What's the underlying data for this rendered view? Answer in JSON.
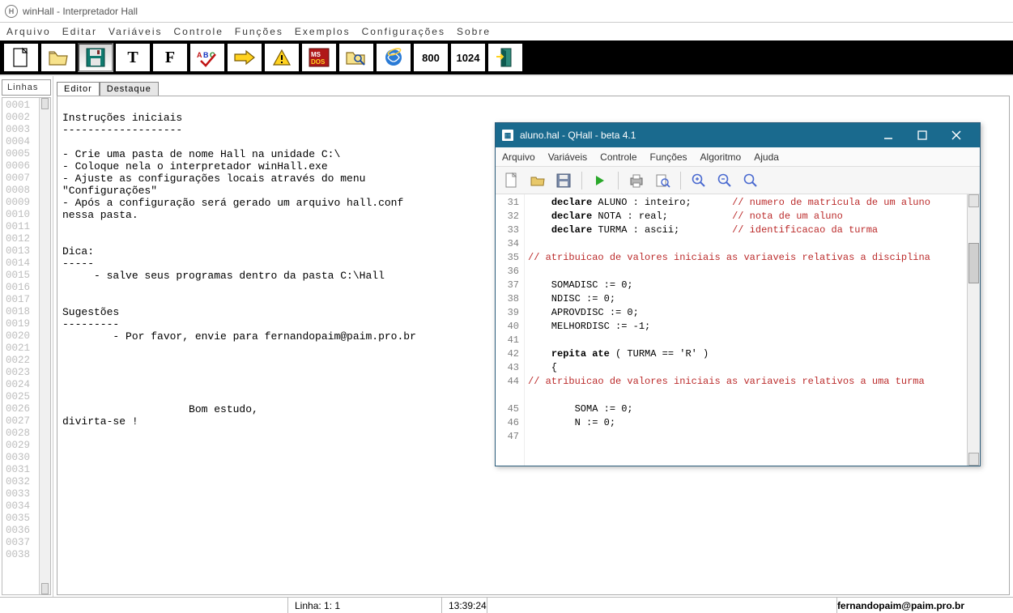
{
  "titlebar": {
    "title": "winHall - Interpretador Hall"
  },
  "menubar": {
    "items": [
      "Arquivo",
      "Editar",
      "Variáveis",
      "Controle",
      "Funções",
      "Exemplos",
      "Configurações",
      "Sobre"
    ]
  },
  "toolbar": {
    "size1": "800",
    "size2": "1024"
  },
  "linhas": {
    "label": "Linhas",
    "numbers": "0001\n0002\n0003\n0004\n0005\n0006\n0007\n0008\n0009\n0010\n0011\n0012\n0013\n0014\n0015\n0016\n0017\n0018\n0019\n0020\n0021\n0022\n0023\n0024\n0025\n0026\n0027\n0028\n0029\n0030\n0031\n0032\n0033\n0034\n0035\n0036\n0037\n0038"
  },
  "editor": {
    "tabs": {
      "active": "Editor",
      "inactive": "Destaque"
    },
    "text": "\nInstruções iniciais\n-------------------\n\n- Crie uma pasta de nome Hall na unidade C:\\\n- Coloque nela o interpretador winHall.exe\n- Ajuste as configurações locais através do menu\n\"Configurações\"\n- Após a configuração será gerado um arquivo hall.conf\nnessa pasta.\n\n\nDica:\n-----\n     - salve seus programas dentro da pasta C:\\Hall\n\n\nSugestões\n---------\n        - Por favor, envie para fernandopaim@paim.pro.br\n\n\n\n\n\n                    Bom estudo,\ndivirta-se !"
  },
  "qhall": {
    "title": "aluno.hal - QHall - beta 4.1",
    "menu": [
      "Arquivo",
      "Variáveis",
      "Controle",
      "Funções",
      "Algoritmo",
      "Ajuda"
    ],
    "gutter": "31\n32\n33\n34\n35\n36\n37\n38\n39\n40\n41\n42\n43\n44\n\n45\n46\n47",
    "lines": [
      {
        "indent": "    ",
        "kw": "declare",
        "rest": " ALUNO : inteiro;",
        "cmpad": "       ",
        "cm": "// numero de matricula de um aluno"
      },
      {
        "indent": "    ",
        "kw": "declare",
        "rest": " NOTA : real;",
        "cmpad": "           ",
        "cm": "// nota de um aluno"
      },
      {
        "indent": "    ",
        "kw": "declare",
        "rest": " TURMA : ascii;",
        "cmpad": "         ",
        "cm": "// identificacao da turma"
      },
      {
        "plain": ""
      },
      {
        "indent": "    ",
        "cm": "// atribuicao de valores iniciais as variaveis relativas a disciplina",
        "wrap": true
      },
      {
        "plain": ""
      },
      {
        "indent": "    ",
        "plain": "SOMADISC := 0;"
      },
      {
        "indent": "    ",
        "plain": "NDISC := 0;"
      },
      {
        "indent": "    ",
        "plain": "APROVDISC := 0;"
      },
      {
        "indent": "    ",
        "plain": "MELHORDISC := -1;"
      },
      {
        "plain": ""
      },
      {
        "indent": "    ",
        "kw": "repita ate",
        "rest": " ( TURMA == 'R' )"
      },
      {
        "indent": "    ",
        "plain": "{"
      },
      {
        "indent": "        ",
        "cm": "// atribuicao de valores iniciais as variaveis relativos a uma turma",
        "wrap": true
      },
      {
        "plain": ""
      },
      {
        "indent": "        ",
        "plain": "SOMA := 0;"
      },
      {
        "indent": "        ",
        "plain": "N := 0;"
      }
    ]
  },
  "status": {
    "line": "Linha: 1: 1",
    "time": "13:39:24",
    "email": "fernandopaim@paim.pro.br"
  }
}
